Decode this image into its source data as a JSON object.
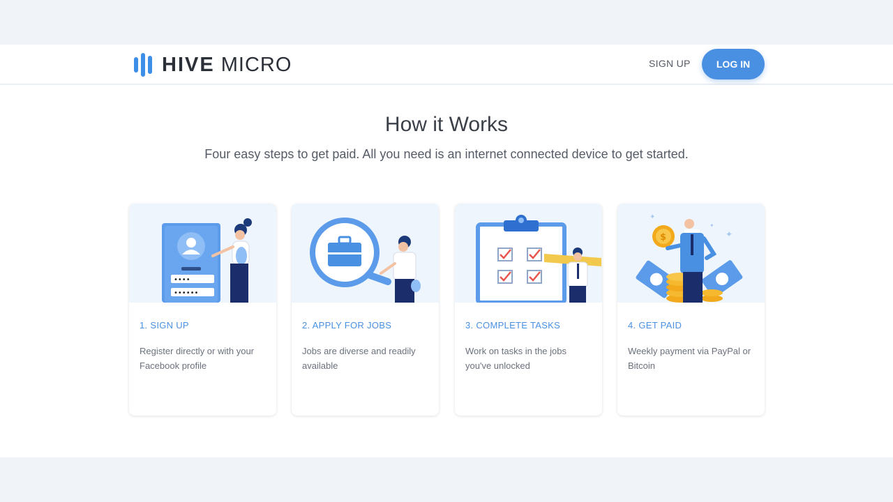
{
  "header": {
    "logo_bold": "HIVE",
    "logo_light": "MICRO",
    "signup_label": "SIGN UP",
    "login_label": "LOG IN"
  },
  "hero": {
    "title": "How it Works",
    "subtitle": "Four easy steps to get paid. All you need is an internet connected device to get started."
  },
  "steps": [
    {
      "title": "1. SIGN UP",
      "description": "Register directly or with your Facebook profile",
      "illustration": "signup-illustration"
    },
    {
      "title": "2. APPLY FOR JOBS",
      "description": "Jobs are diverse and readily available",
      "illustration": "apply-jobs-illustration"
    },
    {
      "title": "3. COMPLETE TASKS",
      "description": "Work on tasks in the jobs you've unlocked",
      "illustration": "complete-tasks-illustration"
    },
    {
      "title": "4. GET PAID",
      "description": "Weekly payment via PayPal or Bitcoin",
      "illustration": "get-paid-illustration"
    }
  ],
  "colors": {
    "accent": "#4a90e2",
    "page_band": "#f0f4f9",
    "card_image_bg": "#eef5fd",
    "text_dark": "#3a3f48"
  }
}
